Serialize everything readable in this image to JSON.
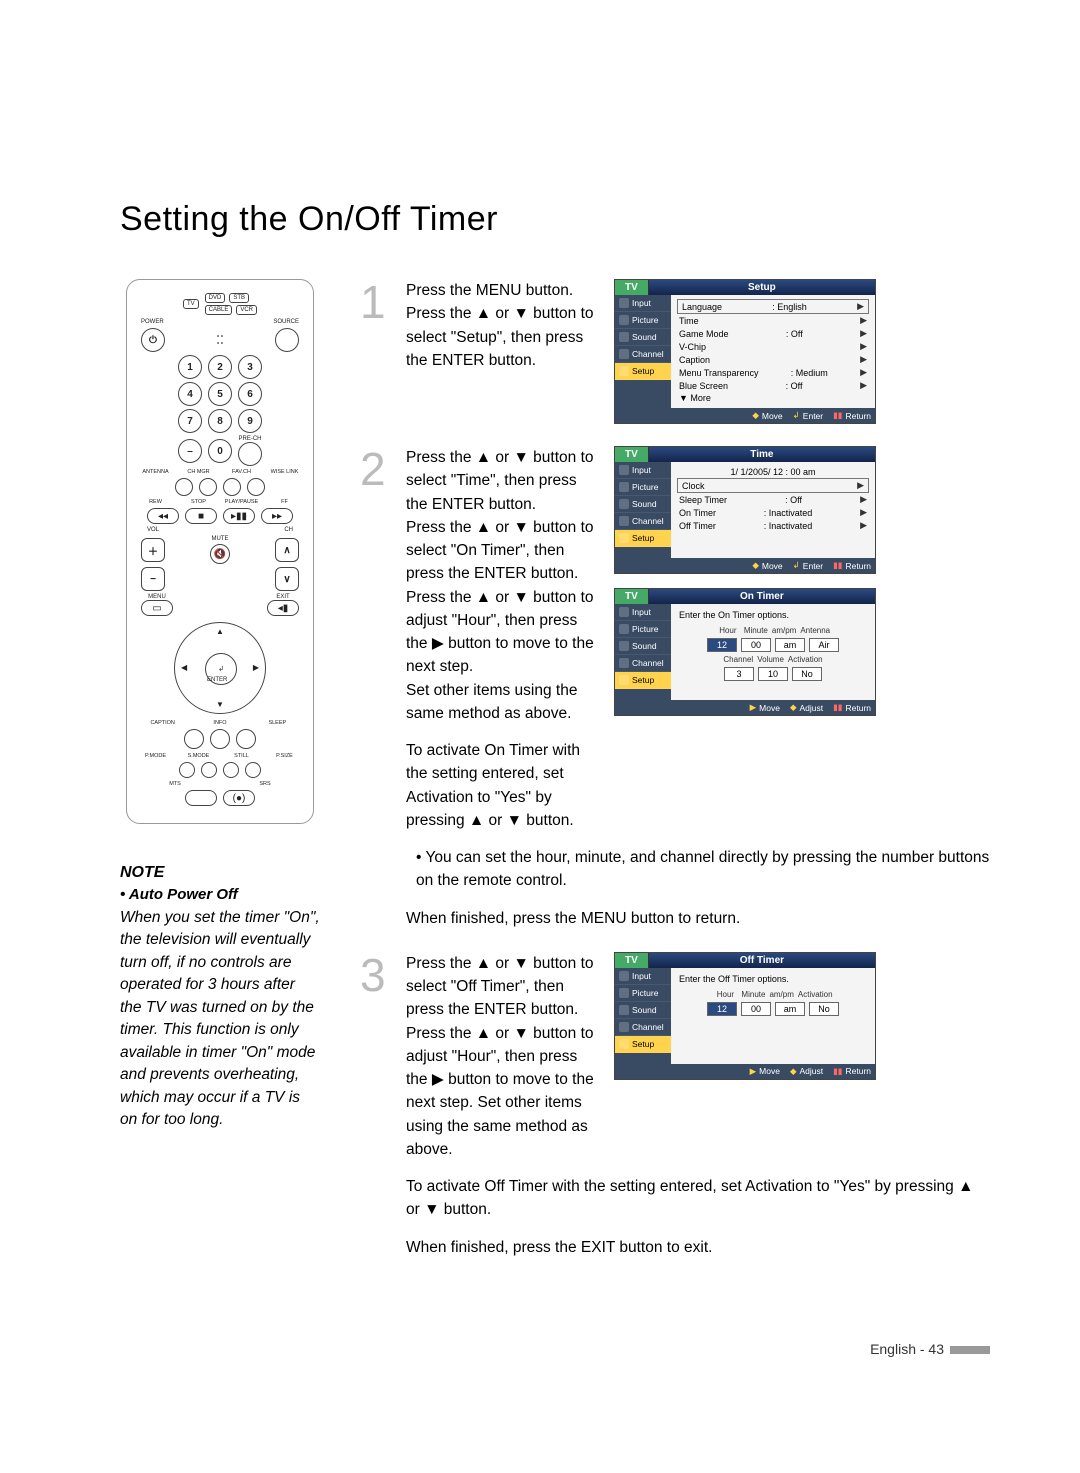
{
  "title": "Setting the On/Off Timer",
  "remote": {
    "tv": "TV",
    "dvd": "DVD",
    "stb": "STB",
    "cable": "CABLE",
    "vcr": "VCR",
    "power": "POWER",
    "source": "SOURCE",
    "n1": "1",
    "n2": "2",
    "n3": "3",
    "n4": "4",
    "n5": "5",
    "n6": "6",
    "n7": "7",
    "n8": "8",
    "n9": "9",
    "n0": "0",
    "dash": "–",
    "prech": "PRE-CH",
    "ant": "ANTENNA",
    "chmgr": "CH MGR",
    "fav": "FAV.CH",
    "wise": "WISE LINK",
    "rew": "REW",
    "stop": "STOP",
    "play": "PLAY/PAUSE",
    "ff": "FF",
    "vol": "VOL",
    "ch": "CH",
    "mute": "MUTE",
    "menu": "MENU",
    "exit": "EXIT",
    "enter": "ENTER",
    "caption": "CAPTION",
    "info": "INFO",
    "sleep": "SLEEP",
    "pmode": "P.MODE",
    "smode": "S.MODE",
    "still": "STILL",
    "psize": "P.SIZE",
    "mts": "MTS",
    "srs": "SRS"
  },
  "note": {
    "heading": "NOTE",
    "sub": "• Auto Power Off",
    "body": "When you set the timer \"On\", the television will eventually turn off, if no controls are operated for 3 hours after the TV was turned on by the timer. This function is only available in timer \"On\" mode and prevents overheating, which may occur if a TV is on for too long."
  },
  "steps": {
    "s1": {
      "num": "1",
      "text": "Press the MENU button. Press the ▲ or ▼ button to select \"Setup\", then press the ENTER button."
    },
    "s2": {
      "num": "2",
      "textA": "Press the ▲ or ▼ button to select \"Time\", then press the ENTER button.\nPress the ▲ or ▼ button to select \"On Timer\", then press the ENTER button. Press the ▲ or ▼ button to adjust \"Hour\", then press the ▶ button to move to the next step.\nSet other items using the same method as above.",
      "textB": "To activate On Timer with the setting entered, set Activation to \"Yes\" by pressing ▲ or ▼ button.",
      "bullet": "You can set the hour, minute, and channel directly by pressing the number buttons on the remote control.",
      "after": "When finished, press the MENU button to return."
    },
    "s3": {
      "num": "3",
      "text": "Press the ▲ or ▼ button to select \"Off Timer\", then press the ENTER button. Press the ▲ or ▼ button to adjust \"Hour\", then press the ▶ button to move to the next step. Set other items using the same method as above.",
      "afterA": "To activate Off Timer with the setting entered, set Activation to \"Yes\" by pressing ▲ or ▼ button.",
      "afterB": "When finished, press the EXIT button to exit."
    }
  },
  "osd": {
    "tv": "TV",
    "side": {
      "input": "Input",
      "picture": "Picture",
      "sound": "Sound",
      "channel": "Channel",
      "setup": "Setup"
    },
    "hints": {
      "move": "Move",
      "enter": "Enter",
      "return": "Return",
      "adjust": "Adjust"
    },
    "setup": {
      "title": "Setup",
      "lang_l": "Language",
      "lang_v": ": English",
      "time": "Time",
      "game_l": "Game Mode",
      "game_v": ": Off",
      "vchip": "V-Chip",
      "caption": "Caption",
      "trans_l": "Menu Transparency",
      "trans_v": ": Medium",
      "bs_l": "Blue Screen",
      "bs_v": ": Off",
      "more": "▼ More"
    },
    "time": {
      "title": "Time",
      "now": "1/ 1/2005/ 12 : 00 am",
      "clock": "Clock",
      "sleep_l": "Sleep Timer",
      "sleep_v": ": Off",
      "on_l": "On Timer",
      "on_v": ": Inactivated",
      "off_l": "Off Timer",
      "off_v": ": Inactivated"
    },
    "ontimer": {
      "title": "On Timer",
      "prompt": "Enter the On Timer options.",
      "h1": "Hour",
      "h2": "Minute",
      "h3": "am/pm",
      "h4": "Antenna",
      "v1": "12",
      "v2": "00",
      "v3": "am",
      "v4": "Air",
      "h5": "Channel",
      "h6": "Volume",
      "h7": "Activation",
      "v5": "3",
      "v6": "10",
      "v7": "No"
    },
    "offtimer": {
      "title": "Off Timer",
      "prompt": "Enter the Off Timer options.",
      "h1": "Hour",
      "h2": "Minute",
      "h3": "am/pm",
      "h4": "Activation",
      "v1": "12",
      "v2": "00",
      "v3": "am",
      "v4": "No"
    }
  },
  "footer": "English - 43"
}
